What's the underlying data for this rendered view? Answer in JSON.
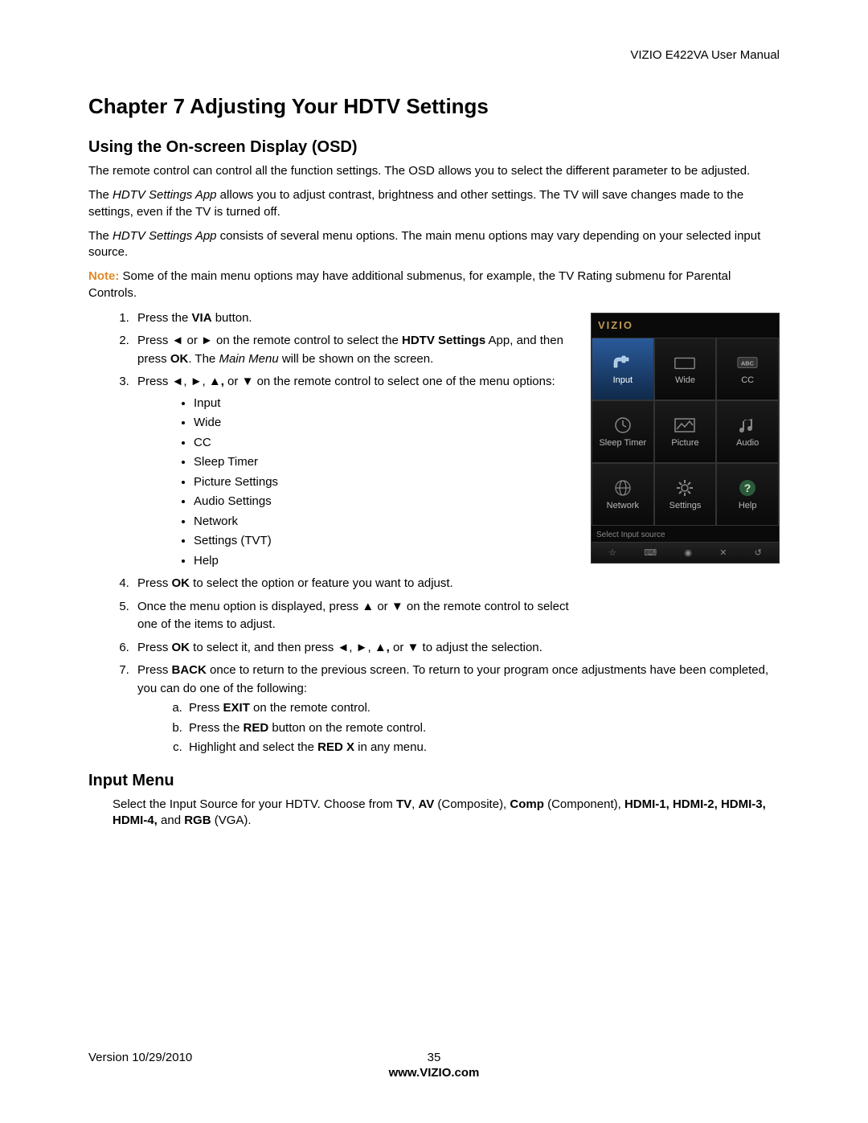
{
  "header": {
    "manual_title": "VIZIO E422VA User Manual"
  },
  "chapter": {
    "title": "Chapter 7 Adjusting Your HDTV Settings"
  },
  "section_osd": {
    "title": "Using the On-screen Display (OSD)",
    "para1": "The remote control can control all the function settings. The OSD allows you to select the different parameter to be adjusted.",
    "para2_pre": "The ",
    "para2_app": "HDTV Settings App",
    "para2_post": " allows you to adjust contrast, brightness and other settings. The TV will save changes made to the settings, even if the TV is turned off.",
    "para3_pre": "The ",
    "para3_app": "HDTV Settings App",
    "para3_post": " consists of several menu options. The main menu options may vary depending on your selected input source.",
    "note_label": "Note:",
    "note_text": "  Some of the main menu options may have additional submenus, for example, the TV Rating submenu for Parental Controls."
  },
  "steps": {
    "s1_pre": "Press the ",
    "s1_b": "VIA",
    "s1_post": " button.",
    "s2_a": "Press ◄ or ► on the remote control to select the ",
    "s2_b1": "HDTV Settings",
    "s2_mid": " App, and then press ",
    "s2_b2": "OK",
    "s2_c": ". The ",
    "s2_i": "Main Menu",
    "s2_d": " will be shown on the screen.",
    "s3_a": "Press ◄, ►, ▲",
    "s3_comma": ",",
    "s3_b": " or ▼ on the remote control to select one of the menu options:",
    "options": [
      "Input",
      "Wide",
      "CC",
      "Sleep Timer",
      "Picture Settings",
      "Audio Settings",
      "Network",
      "Settings (TVT)",
      "Help"
    ],
    "s4_a": "Press ",
    "s4_b": "OK",
    "s4_c": " to select the option or feature you want to adjust.",
    "s5": "Once the menu option is displayed, press ▲ or ▼ on the remote control to select one of the items to adjust.",
    "s6_a": "Press ",
    "s6_b": "OK",
    "s6_c": " to select it, and then press ◄, ►, ▲",
    "s6_comma": ",",
    "s6_d": " or ▼ to adjust the selection.",
    "s7_a": "Press ",
    "s7_b": "BACK",
    "s7_c": " once to return to the previous screen. To return to your program once adjustments have been completed, you can do one of the following:",
    "sub_a_a": "Press ",
    "sub_a_b": "EXIT",
    "sub_a_c": " on the remote control.",
    "sub_b_a": "Press the ",
    "sub_b_b": "RED",
    "sub_b_c": " button on the remote control.",
    "sub_c_a": "Highlight and select the ",
    "sub_c_b": "RED X",
    "sub_c_c": " in any menu."
  },
  "section_input": {
    "title": "Input Menu",
    "p_a": "Select the Input Source for your HDTV. Choose from ",
    "p_tv": "TV",
    "p_sep1": ", ",
    "p_av": "AV",
    "p_av2": " (Composite), ",
    "p_comp": "Comp",
    "p_comp2": " (Component), ",
    "p_hdmi": "HDMI-1, HDMI-2, HDMI-3, HDMI-4,",
    "p_and": " and ",
    "p_rgb": "RGB",
    "p_rgb2": " (VGA)."
  },
  "osd": {
    "logo": "VIZIO",
    "cells": [
      {
        "label": "Input",
        "selected": true,
        "icon": "plug"
      },
      {
        "label": "Wide",
        "selected": false,
        "icon": "wide"
      },
      {
        "label": "CC",
        "selected": false,
        "icon": "cc"
      },
      {
        "label": "Sleep Timer",
        "selected": false,
        "icon": "clock"
      },
      {
        "label": "Picture",
        "selected": false,
        "icon": "picture"
      },
      {
        "label": "Audio",
        "selected": false,
        "icon": "audio"
      },
      {
        "label": "Network",
        "selected": false,
        "icon": "net"
      },
      {
        "label": "Settings",
        "selected": false,
        "icon": "gear"
      },
      {
        "label": "Help",
        "selected": false,
        "icon": "help"
      }
    ],
    "status": "Select Input source",
    "bottom_icons": [
      "☆",
      "⌨",
      "◉",
      "✕",
      "↺"
    ]
  },
  "footer": {
    "version": "Version 10/29/2010",
    "page": "35",
    "url": "www.VIZIO.com"
  },
  "arrows": {
    "left": "◄",
    "right": "►",
    "up": "▲",
    "down": "▼"
  }
}
